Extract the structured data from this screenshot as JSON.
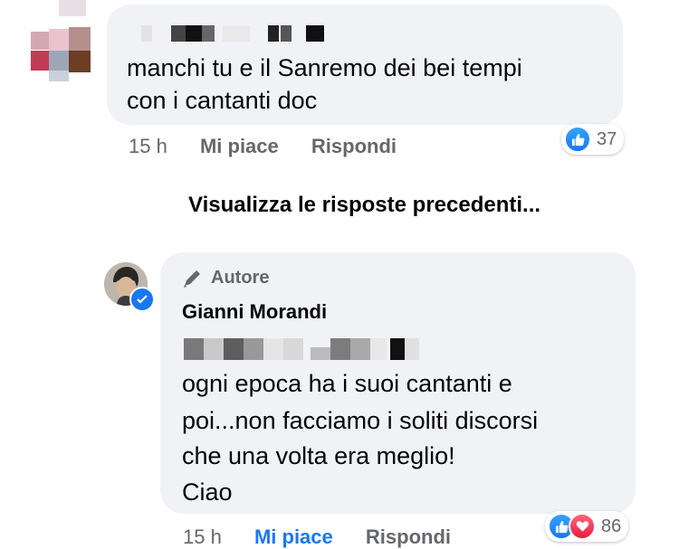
{
  "comment1": {
    "text_line1": "manchi tu e il Sanremo dei bei tempi",
    "text_line2": "con i cantanti doc",
    "time": "15 h",
    "like_label": "Mi piace",
    "reply_label": "Rispondi",
    "reaction_count": "37"
  },
  "view_previous": "Visualizza le risposte precedenti...",
  "comment2": {
    "author_badge": "Autore",
    "author_name": "Gianni Morandi",
    "text_lines": [
      "ogni epoca ha i suoi cantanti e",
      "poi...non facciamo i soliti discorsi",
      "che una volta era meglio!",
      "Ciao"
    ],
    "time": "15 h",
    "like_label": "Mi piace",
    "reply_label": "Rispondi",
    "reaction_count": "86"
  },
  "colors": {
    "bubble": "#f0f2f5",
    "meta_gray": "#65676b",
    "link_blue": "#1877f2",
    "love_red": "#e61e3c"
  },
  "icons": [
    "blurred-avatar",
    "like-icon",
    "love-icon",
    "pencil-icon",
    "verified-badge-icon",
    "author-avatar"
  ]
}
